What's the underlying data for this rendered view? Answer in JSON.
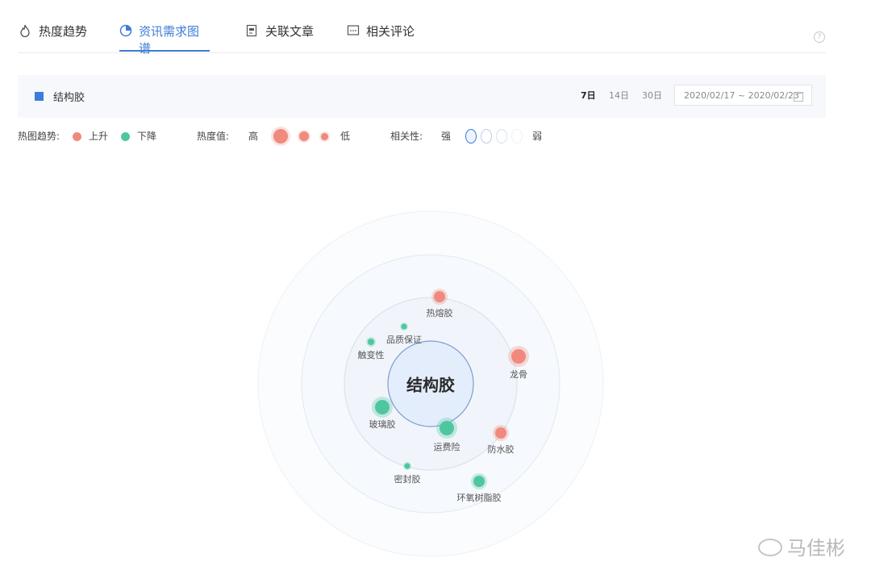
{
  "tabs": [
    {
      "label": "热度趋势",
      "icon": "flame-icon"
    },
    {
      "label": "资讯需求图谱",
      "icon": "pie-chart-icon"
    },
    {
      "label": "关联文章",
      "icon": "document-icon"
    },
    {
      "label": "相关评论",
      "icon": "comment-icon"
    }
  ],
  "active_tab": "资讯需求图谱",
  "help": {
    "symbol": "?"
  },
  "filter": {
    "keyword": "结构胶",
    "keyword_color": "#3d7be0",
    "ranges": [
      "7日",
      "14日",
      "30日"
    ],
    "selected_range": "7日",
    "date_range": "2020/02/17 ~ 2020/02/23"
  },
  "legend": {
    "trend_label": "热图趋势:",
    "up_label": "上升",
    "down_label": "下降",
    "heat_label": "热度值:",
    "high_label": "高",
    "low_label": "低",
    "relevance_label": "相关性:",
    "strong_label": "强",
    "weak_label": "弱",
    "colors": {
      "up": "#f08a7e",
      "down": "#4fc79e",
      "accent": "#3e7bd8"
    }
  },
  "graph": {
    "center": "结构胶",
    "nodes": [
      {
        "label": "热熔胶",
        "trend": "up"
      },
      {
        "label": "品质保证",
        "trend": "down"
      },
      {
        "label": "触变性",
        "trend": "down"
      },
      {
        "label": "龙骨",
        "trend": "up"
      },
      {
        "label": "玻璃胶",
        "trend": "down"
      },
      {
        "label": "运费险",
        "trend": "down"
      },
      {
        "label": "防水胶",
        "trend": "up"
      },
      {
        "label": "密封胶",
        "trend": "down"
      },
      {
        "label": "环氧树脂胶",
        "trend": "down"
      }
    ]
  },
  "watermark": "马佳彬"
}
